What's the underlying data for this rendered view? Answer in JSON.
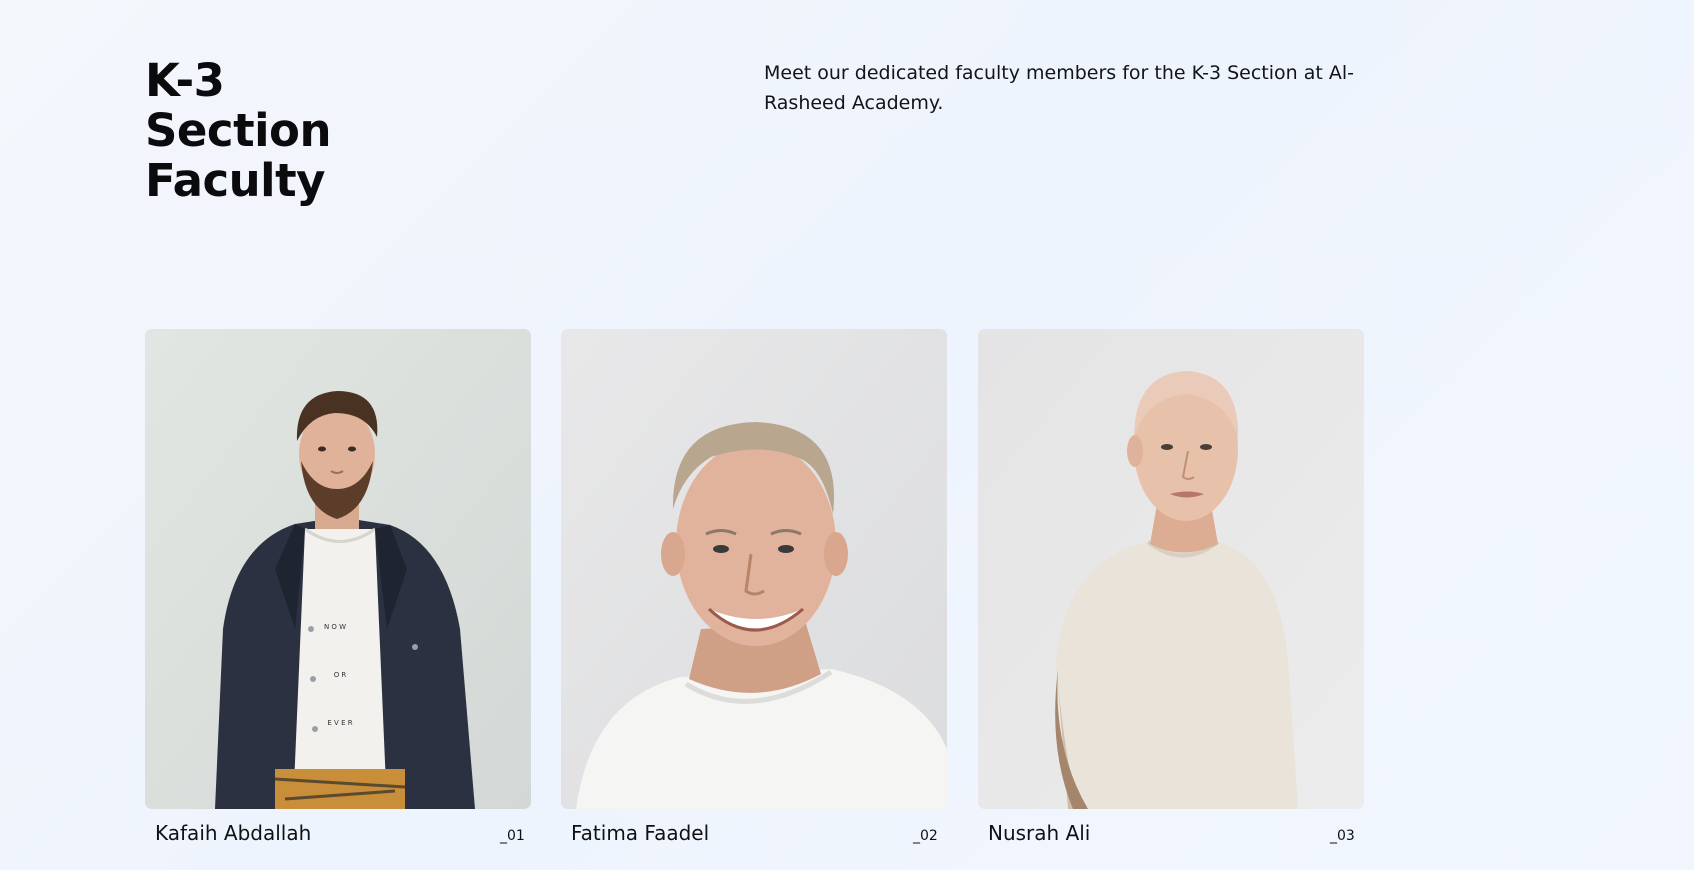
{
  "section": {
    "title_lines": [
      "K-3",
      "Section",
      "Faculty"
    ],
    "intro": "Meet our dedicated faculty members for the K-3 Section at Al-Rasheed Academy."
  },
  "faculty": [
    {
      "name": "Kafaih Abdallah",
      "index": "_01",
      "photo_icon": "portrait-man-denim-jacket",
      "background_color": "#dde1de"
    },
    {
      "name": "Fatima Faadel",
      "index": "_02",
      "photo_icon": "portrait-smiling-man-white-tee",
      "background_color": "#e4e5e6"
    },
    {
      "name": "Nusrah Ali",
      "index": "_03",
      "photo_icon": "portrait-woman-beige-tee",
      "background_color": "#e6e6e6"
    }
  ],
  "colors": {
    "background": "#eef4fd",
    "text": "#0c0c0f"
  }
}
